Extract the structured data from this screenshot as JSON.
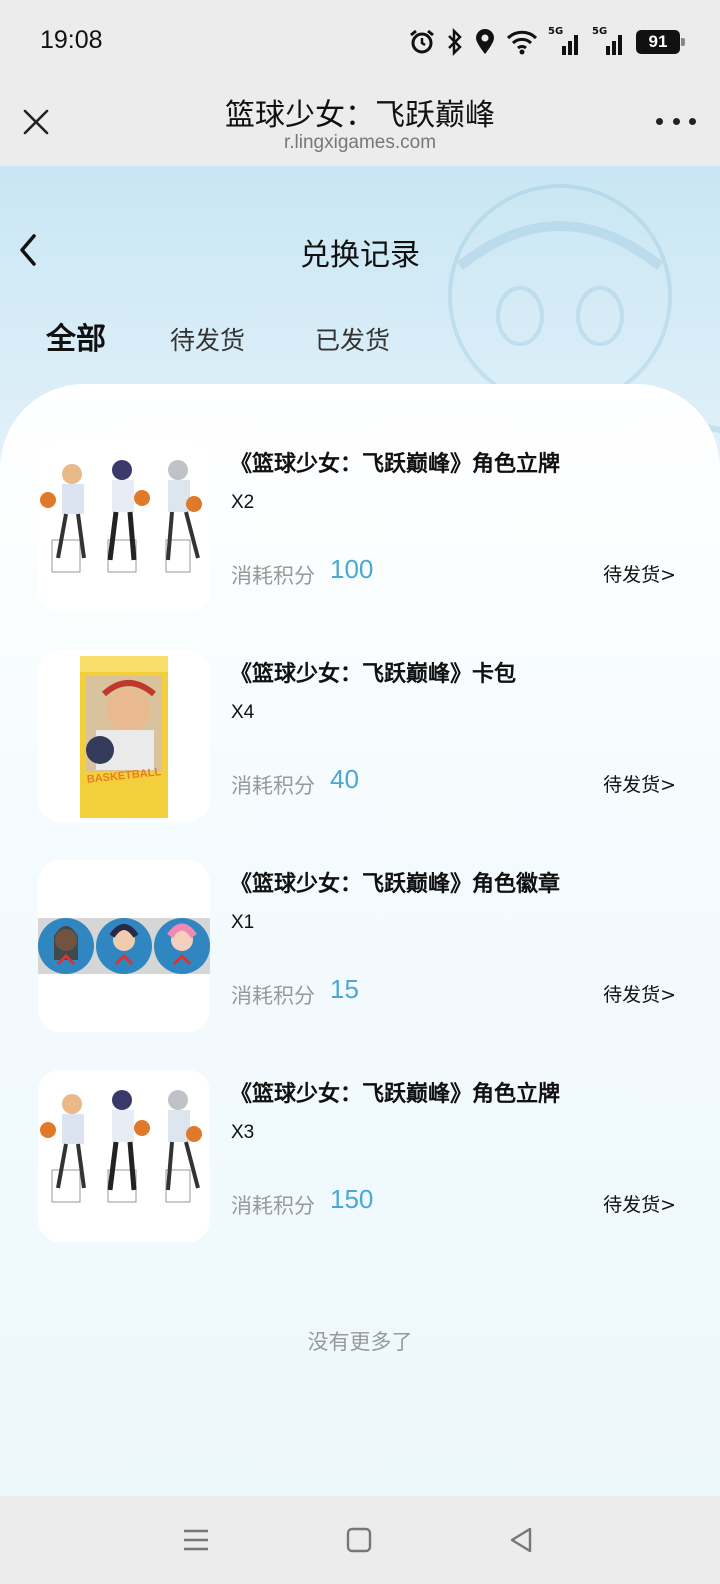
{
  "status_bar": {
    "time": "19:08",
    "battery": "91",
    "net1": "5G",
    "net2": "5G"
  },
  "webview": {
    "title": "篮球少女：飞跃巅峰",
    "url": "r.lingxigames.com"
  },
  "page": {
    "title": "兑换记录"
  },
  "tabs": [
    {
      "label": "全部",
      "active": true
    },
    {
      "label": "待发货",
      "active": false
    },
    {
      "label": "已发货",
      "active": false
    }
  ],
  "records": [
    {
      "name": "《篮球少女：飞跃巅峰》角色立牌",
      "qty": "X2",
      "cost_label": "消耗积分",
      "cost": "100",
      "status": "待发货>",
      "thumb": "standee-image"
    },
    {
      "name": "《篮球少女：飞跃巅峰》卡包",
      "qty": "X4",
      "cost_label": "消耗积分",
      "cost": "40",
      "status": "待发货>",
      "thumb": "card-pack-image",
      "thumb_text": "BASKETBALL"
    },
    {
      "name": "《篮球少女：飞跃巅峰》角色徽章",
      "qty": "X1",
      "cost_label": "消耗积分",
      "cost": "15",
      "status": "待发货>",
      "thumb": "badge-image"
    },
    {
      "name": "《篮球少女：飞跃巅峰》角色立牌",
      "qty": "X3",
      "cost_label": "消耗积分",
      "cost": "150",
      "status": "待发货>",
      "thumb": "standee-image"
    }
  ],
  "footer": {
    "no_more": "没有更多了"
  },
  "colors": {
    "accent": "#4aa8d4",
    "muted": "#999999",
    "background": "#ececec"
  }
}
